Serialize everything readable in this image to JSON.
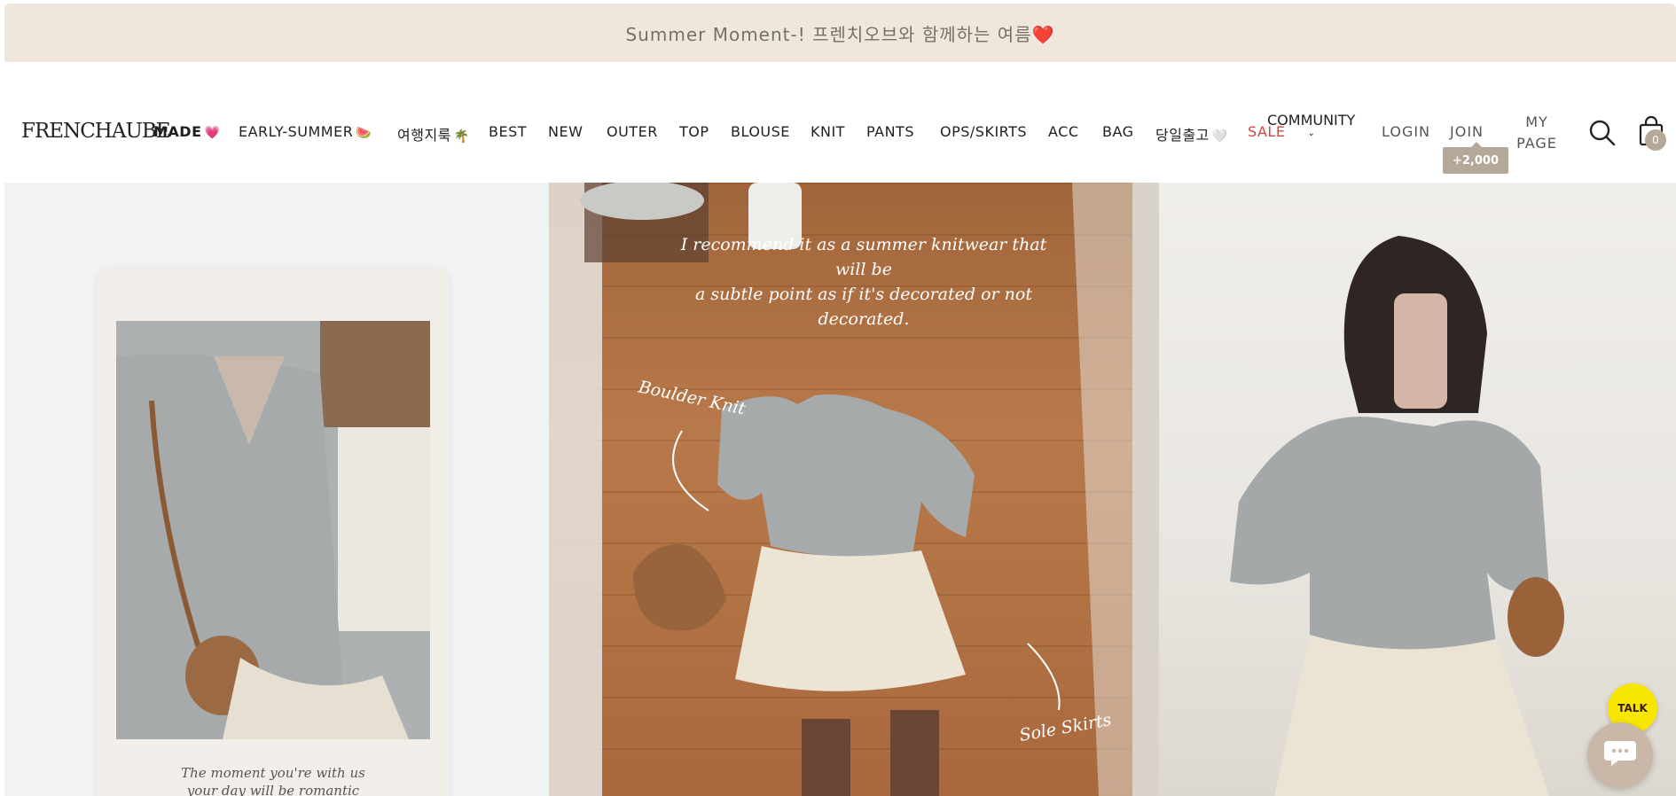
{
  "announcement": {
    "text": "Summer Moment-! 프렌치오브와 함께하는 여름❤️"
  },
  "header": {
    "logo": "FRENCHAUBE",
    "nav": [
      {
        "label": "MADE",
        "emoji": "💗"
      },
      {
        "label": "EARLY-SUMMER",
        "emoji": "🍉"
      },
      {
        "label": "여행지룩",
        "emoji": "🌴"
      },
      {
        "label": "BEST",
        "emoji": ""
      },
      {
        "label": "NEW",
        "emoji": ""
      },
      {
        "label": "OUTER",
        "emoji": ""
      },
      {
        "label": "TOP",
        "emoji": ""
      },
      {
        "label": "BLOUSE",
        "emoji": ""
      },
      {
        "label": "KNIT",
        "emoji": ""
      },
      {
        "label": "PANTS",
        "emoji": ""
      },
      {
        "label": "OPS/SKIRTS",
        "emoji": ""
      },
      {
        "label": "ACC",
        "emoji": ""
      },
      {
        "label": "BAG",
        "emoji": ""
      },
      {
        "label": "당일출고",
        "emoji": "🤍"
      },
      {
        "label": "SALE",
        "emoji": ""
      }
    ],
    "community": {
      "label": "COMMUNITY",
      "chevron": "⌄"
    },
    "login": "LOGIN",
    "join": "JOIN",
    "join_badge": "+2,000",
    "mypage_line1": "MY",
    "mypage_line2": "PAGE",
    "cart_count": "0",
    "icons": {
      "search": "search-icon",
      "cart": "shopping-bag-icon"
    }
  },
  "hero": {
    "card_caption_line1": "The moment you're with us",
    "card_caption_line2": "your day will be romantic",
    "mid_text_line1": "I recommend it as a summer knitwear that will be",
    "mid_text_line2": "a subtle point as if it's decorated or not decorated.",
    "annotation_1": "Boulder Knit",
    "annotation_2": "Sole Skirts"
  },
  "floating": {
    "talk_label": "TALK",
    "chat_icon": "chat-bubble-icon"
  },
  "colors": {
    "announcement_bg": "#efe7dc",
    "sale": "#d6453c",
    "badge": "#b5a898",
    "talk": "#f7e600"
  }
}
